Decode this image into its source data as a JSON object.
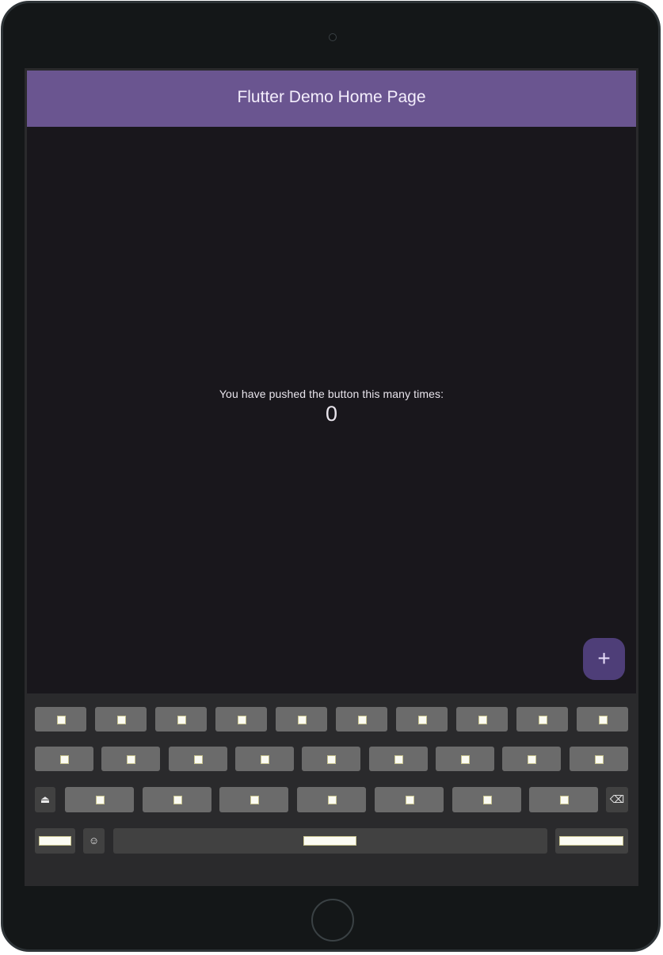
{
  "app": {
    "title": "Flutter Demo Home Page",
    "message": "You have pushed the button this many times:",
    "counter": "0",
    "fab_label": "+"
  },
  "colors": {
    "appbar": "#6a5590",
    "background": "#19171c",
    "fab": "#4e3e78",
    "keyboard": "#2a2a2c"
  },
  "keyboard": {
    "shift_symbol": "⏏",
    "emoji_symbol": "☺",
    "backspace_symbol": "⌫",
    "row1_key_count": 10,
    "row2_key_count": 9,
    "row3_key_count": 7
  }
}
